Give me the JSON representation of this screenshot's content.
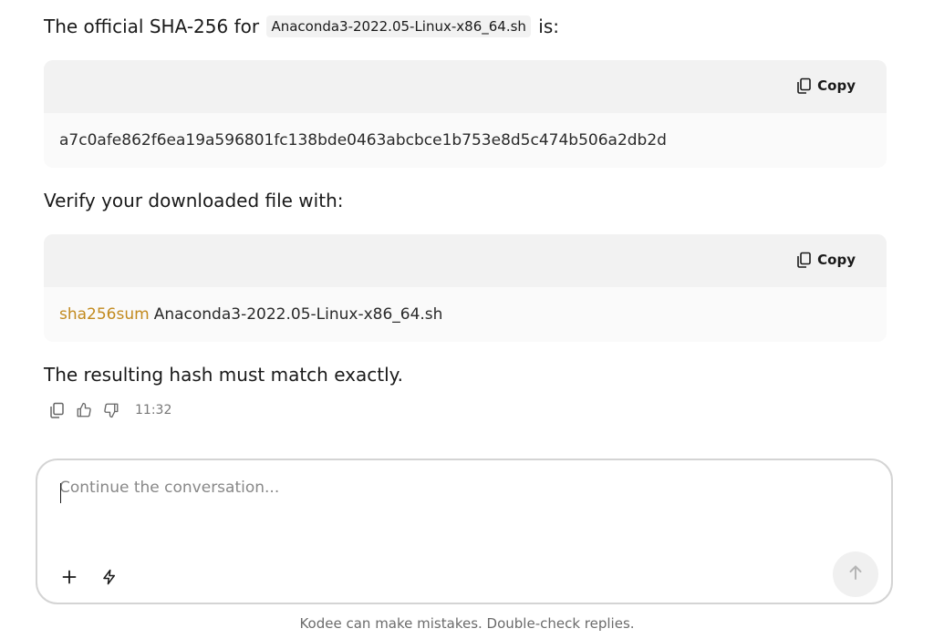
{
  "message": {
    "intro_prefix": "The official SHA-256 for",
    "intro_filename": "Anaconda3-2022.05-Linux-x86_64.sh",
    "intro_suffix": "is:",
    "hash_block": {
      "copy_label": "Copy",
      "code": "a7c0afe862f6ea19a596801fc138bde0463abcbce1b753e8d5c474b506a2db2d"
    },
    "verify_text": "Verify your downloaded file with:",
    "command_block": {
      "copy_label": "Copy",
      "command": "sha256sum",
      "argument": "Anaconda3-2022.05-Linux-x86_64.sh"
    },
    "closing_text": "The resulting hash must match exactly.",
    "timestamp": "11:32"
  },
  "composer": {
    "placeholder": "Continue the conversation..."
  },
  "footer": {
    "disclaimer": "Kodee can make mistakes. Double-check replies."
  },
  "colors": {
    "command_keyword": "#c28a1e"
  }
}
